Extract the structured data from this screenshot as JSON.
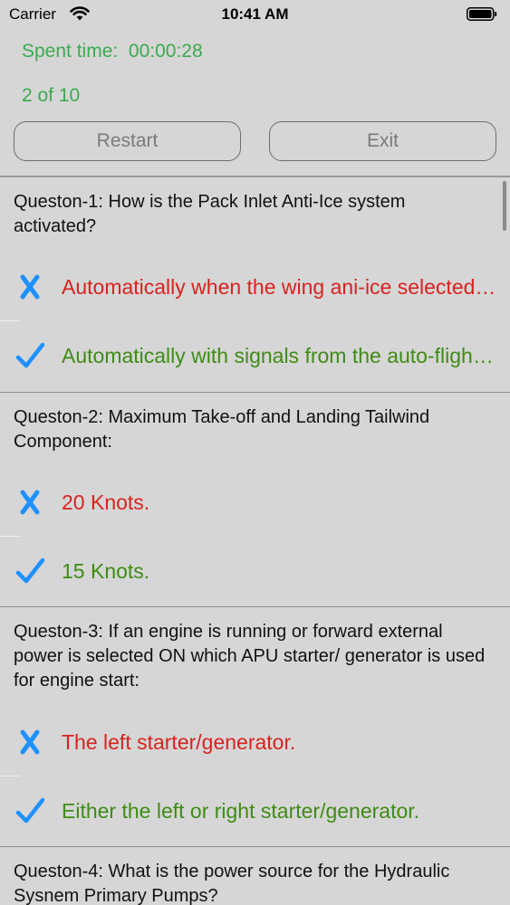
{
  "status_bar": {
    "carrier": "Carrier",
    "time": "10:41 AM",
    "wifi_icon": "wifi-icon",
    "battery_icon": "battery-icon"
  },
  "header": {
    "spent_time": "Spent time:  00:00:28",
    "progress": "2 of 10",
    "restart_label": "Restart",
    "exit_label": "Exit"
  },
  "colors": {
    "wrong": "#d8231f",
    "correct": "#3e8c14",
    "icon_blue": "#1e90ff",
    "accent_green": "#3caa4f"
  },
  "questions": [
    {
      "text": "Queston-1: How is the Pack Inlet Anti-Ice system activated?",
      "wrong_answer": "Automatically when the wing ani-ice selected ON.",
      "correct_answer": "Automatically with signals from the auto-flight system."
    },
    {
      "text": "Queston-2: Maximum Take-off and Landing Tailwind Component:",
      "wrong_answer": "20 Knots.",
      "correct_answer": "15 Knots."
    },
    {
      "text": "Queston-3: If an engine is running or forward external power is selected ON which APU starter/ generator is used for engine start:",
      "wrong_answer": "The left starter/generator.",
      "correct_answer": "Either the left or right starter/generator."
    },
    {
      "text": "Queston-4: What is the power source for the Hydraulic Sysnem Primary Pumps?"
    }
  ]
}
